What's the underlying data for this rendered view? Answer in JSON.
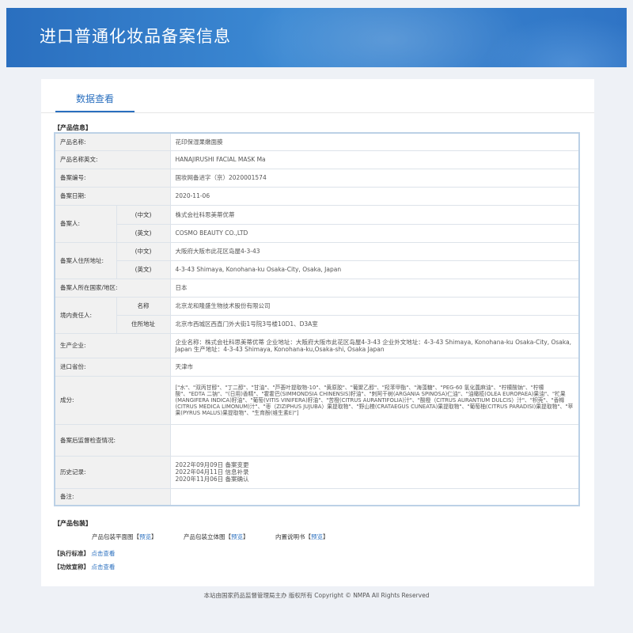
{
  "header": {
    "title": "进口普通化妆品备案信息"
  },
  "tabs": [
    {
      "label": "数据查看"
    }
  ],
  "sections": {
    "product_info": "【产品信息】",
    "product_packaging": "【产品包装】",
    "standard": "【执行标准】",
    "efficacy": "【功效宣称】"
  },
  "product": {
    "name_label": "产品名称:",
    "name": "花印保湿果嫩面膜",
    "name_en_label": "产品名称英文:",
    "name_en": "HANAJIRUSHI FACIAL MASK Ma",
    "record_no_label": "备案编号:",
    "record_no": "国妆网备进字（京）2020001574",
    "record_date_label": "备案日期:",
    "record_date": "2020-11-06",
    "registrant_label": "备案人:",
    "sub_cn": "(中文)",
    "sub_en": "(英文)",
    "registrant_cn": "株式会社科思美蒂优蒂",
    "registrant_en": "COSMO BEAUTY CO.,LTD",
    "address_label": "备案人住所地址:",
    "address_cn": "大阪府大阪市此花区岛屋4-3-43",
    "address_en": "4-3-43 Shimaya, Konohana-ku Osaka-City, Osaka, Japan",
    "country_label": "备案人所在国家/地区:",
    "country": "日本",
    "agent_label": "境内责任人:",
    "agent_name_label": "名称",
    "agent_name": "北京龙和隆盛生物技术股份有限公司",
    "agent_addr_label": "住所地址",
    "agent_addr": "北京市西城区西直门外大街1号院3号楼10D1、D3A室",
    "manufacturer_label": "生产企业:",
    "manufacturer": "企业名称：株式会社科思美蒂优蒂 企业地址：大阪府大阪市此花区岛屋4-3-43 企业外文地址：4-3-43 Shimaya, Konohana-ku Osaka-City, Osaka, Japan 生产地址：4-3-43 Shimaya, Konohana-ku,Osaka-shi, Osaka Japan",
    "port_label": "进口省份:",
    "port": "天津市",
    "ingredients_label": "成分:",
    "ingredients": "[\"水\"、\"双丙甘醇\"、\"丁二醇\"、\"甘油\"、\"芦荟叶提取物-10\"、\"黄原胶\"、\"葡聚乙醇\"、\"羟苯甲酯\"、\"海藻糖\"、\"PEG-60 氢化蓖麻油\"、\"柠檬酸钠\"、\"柠檬酸\"、\"EDTA 二钠\"、\"(日用)香精\"、\"霍霍巴(SIMMONDSIA CHINENSIS)籽油\"、\"刺阿干树(ARGANIA SPINOSA)仁油\"、\"油橄榄(OLEA EUROPAEA)果油\"、\"杧果(MANGIFERA INDICA)籽油\"、\"葡萄(VITIS VINIFERA)籽油\"、\"苦橙(CITRUS AURANTIFOLIA)汁\"、\"酸橙（CITRUS AURANTIUM DULCIS）汁\"、\"枳壳\"、\"香橼(CITRUS MEDICA LIMONUM)汁\"、\"枣（ZIZIPHUS JUJUBA）果提取物\"、\"野山楂(CRATAEGUS CUNEATA)果提取物\"、\"葡萄柚(CITRUS PARADISI)果提取物\"、\"苹果(PYRUS MALUS)果提取物\"、\"生育酚(维生素E)\"]",
    "post_check_label": "备案后监督检查情况:",
    "post_check": "",
    "history_label": "历史记录:",
    "history": [
      "2022年09月09日 备案变更",
      "2022年04月11日 信息补录",
      "2020年11月06日 备案确认"
    ],
    "remark_label": "备注:",
    "remark": ""
  },
  "packaging": {
    "flat_label": "产品包装平面图",
    "flat_link": "预览",
    "solid_label": "产品包装立体图",
    "solid_link": "预览",
    "manual_label": "内置说明书",
    "manual_link": "预览",
    "open_bracket": "【",
    "close_bracket": "】"
  },
  "links": {
    "standard": "点击查看",
    "efficacy": "点击查看"
  },
  "footer": {
    "text": "本站由国家药品监督管理局主办 版权所有 Copyright © NMPA All Rights Reserved"
  }
}
